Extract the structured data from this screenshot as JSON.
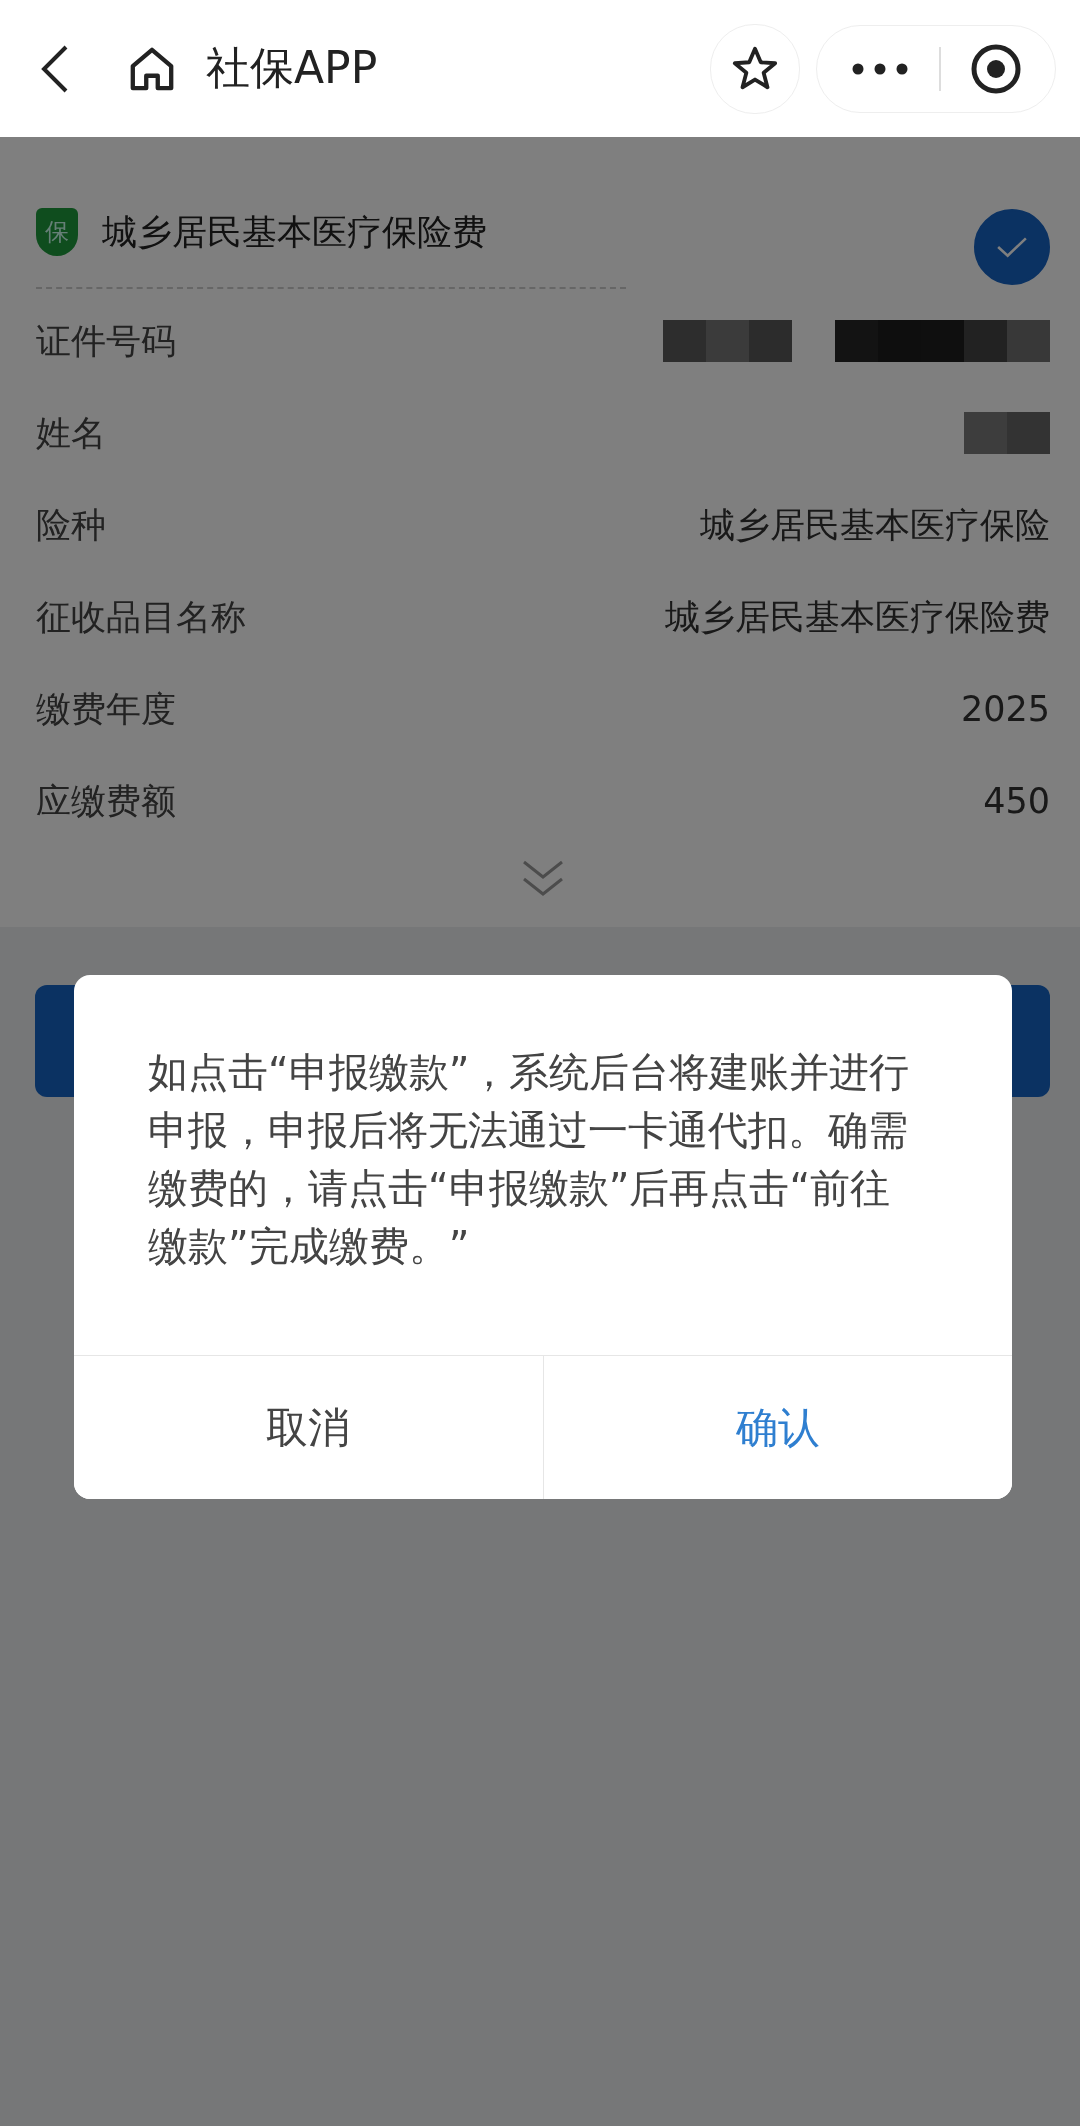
{
  "nav_bar": {
    "title": "社保APP"
  },
  "card": {
    "badge": "保",
    "title": "城乡居民基本医疗保险费",
    "selected": true,
    "rows": [
      {
        "kind": "redacted",
        "label": "证件号码"
      },
      {
        "kind": "redacted",
        "label": "姓名"
      },
      {
        "kind": "text",
        "label": "险种",
        "value": "城乡居民基本医疗保险"
      },
      {
        "kind": "text",
        "label": "征收品目名称",
        "value": "城乡居民基本医疗保险费"
      },
      {
        "kind": "text",
        "label": "缴费年度",
        "value": "2025"
      },
      {
        "kind": "text",
        "label": "应缴费额",
        "value": "450"
      }
    ]
  },
  "dialog": {
    "message": "如点击“申报缴款”，系统后台将建账并进行申报，申报后将无法通过一卡通代扣。确需缴费的，请点击“申报缴款”后再点击“前往缴款”完成缴费。”",
    "buttons": [
      {
        "label": "取消",
        "primary": false
      },
      {
        "label": "确认",
        "primary": true
      }
    ]
  }
}
